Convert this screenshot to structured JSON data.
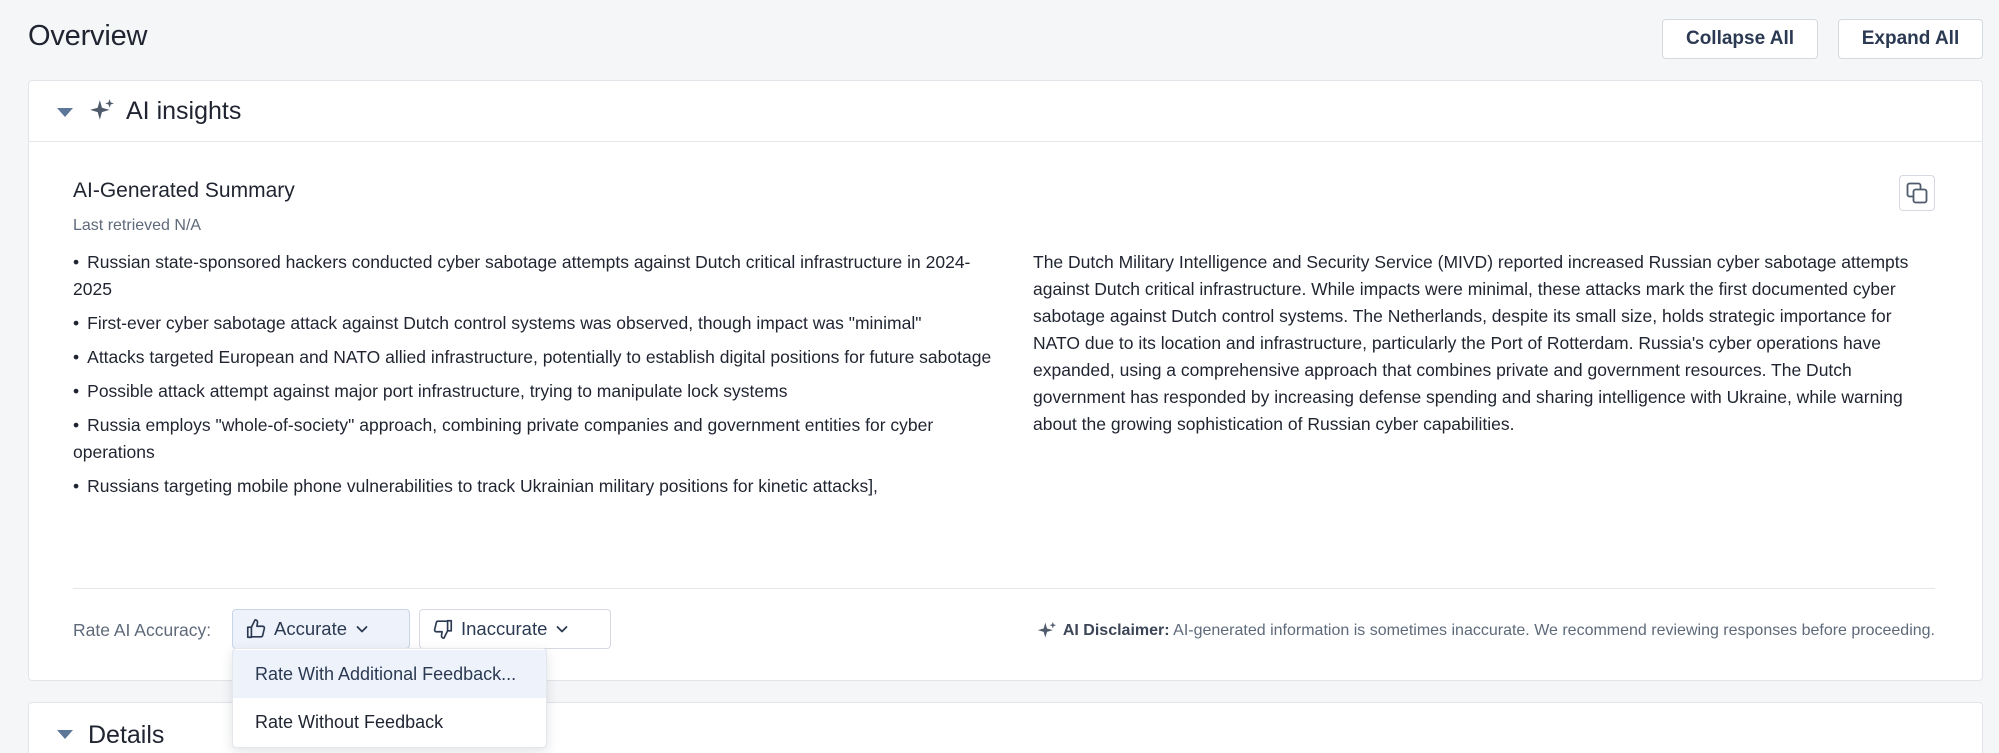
{
  "page": {
    "title": "Overview",
    "collapse_all": "Collapse All",
    "expand_all": "Expand All"
  },
  "ai_insights": {
    "section_title": "AI insights",
    "summary_title": "AI-Generated Summary",
    "last_retrieved": "Last retrieved N/A",
    "bullets": [
      "Russian state-sponsored hackers conducted cyber sabotage attempts against Dutch critical infrastructure in 2024-2025",
      "First-ever cyber sabotage attack against Dutch control systems was observed, though impact was \"minimal\"",
      "Attacks targeted European and NATO allied infrastructure, potentially to establish digital positions for future sabotage",
      "Possible attack attempt against major port infrastructure, trying to manipulate lock systems",
      "Russia employs \"whole-of-society\" approach, combining private companies and government entities for cyber operations",
      "Russians targeting mobile phone vulnerabilities to track Ukrainian military positions for kinetic attacks],"
    ],
    "paragraph": "The Dutch Military Intelligence and Security Service (MIVD) reported increased Russian cyber sabotage attempts against Dutch critical infrastructure. While impacts were minimal, these attacks mark the first documented cyber sabotage against Dutch control systems. The Netherlands, despite its small size, holds strategic importance for NATO due to its location and infrastructure, particularly the Port of Rotterdam. Russia's cyber operations have expanded, using a comprehensive approach that combines private and government resources. The Dutch government has responded by increasing defense spending and sharing intelligence with Ukraine, while warning about the growing sophistication of Russian cyber capabilities.",
    "rate_label": "Rate AI Accuracy:",
    "accurate_label": "Accurate",
    "inaccurate_label": "Inaccurate",
    "disclaimer_label": "AI Disclaimer:",
    "disclaimer_text": "AI-generated information is sometimes inaccurate. We recommend reviewing responses before proceeding."
  },
  "dropdown": {
    "items": [
      "Rate With Additional Feedback...",
      "Rate Without Feedback"
    ]
  },
  "details": {
    "section_title": "Details"
  },
  "icons": {
    "sparkle": "sparkle-icon",
    "copy": "copy-icon",
    "thumbs_up": "thumbs-up-icon",
    "thumbs_down": "thumbs-down-icon",
    "chevron": "chevron-down-icon",
    "caret": "caret-down-icon"
  },
  "colors": {
    "accent_blue": "#5d7798",
    "text_dark": "#1f2430",
    "text_muted": "#5e6a7a",
    "selected_bg": "#eef3fb"
  }
}
